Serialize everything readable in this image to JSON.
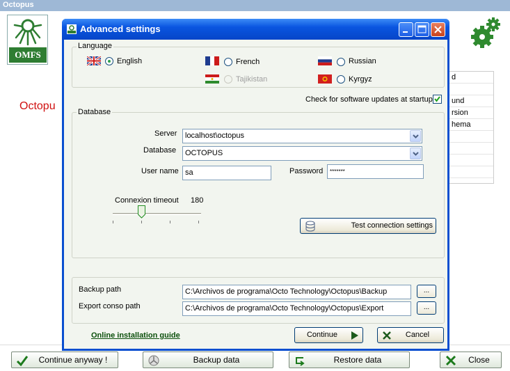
{
  "background": {
    "window_title": "Octopus",
    "logo_text": "OMFS",
    "red_label": "Octopu",
    "list_items": [
      "d",
      "",
      "und",
      "rsion",
      "hema",
      "",
      "",
      "",
      ""
    ],
    "buttons": {
      "continue_anyway": "Continue anyway !",
      "backup": "Backup data",
      "restore": "Restore data",
      "close": "Close"
    }
  },
  "dialog": {
    "title": "Advanced settings",
    "language": {
      "group_label": "Language",
      "options": [
        {
          "label": "English",
          "checked": true,
          "disabled": false
        },
        {
          "label": "French",
          "checked": false,
          "disabled": false
        },
        {
          "label": "Russian",
          "checked": false,
          "disabled": false
        },
        {
          "label": "Tajikistan",
          "checked": false,
          "disabled": true
        },
        {
          "label": "Kyrgyz",
          "checked": false,
          "disabled": false
        }
      ]
    },
    "updates_label": "Check for software updates at startup",
    "database": {
      "group_label": "Database",
      "server_label": "Server",
      "server_value": "localhost\\octopus",
      "database_label": "Database",
      "database_value": "OCTOPUS",
      "username_label": "User name",
      "username_value": "sa",
      "password_label": "Password",
      "password_value": "*******",
      "timeout_label": "Connexion timeout",
      "timeout_value": "180",
      "test_button": "Test connection settings"
    },
    "paths": {
      "backup_label": "Backup path",
      "backup_value": "C:\\Archivos de programa\\Octo Technology\\Octopus\\Backup",
      "export_label": "Export conso path",
      "export_value": "C:\\Archivos de programa\\Octo Technology\\Octopus\\Export",
      "browse_label": "..."
    },
    "guide_link": "Online installation guide",
    "continue_button": "Continue",
    "cancel_button": "Cancel"
  }
}
